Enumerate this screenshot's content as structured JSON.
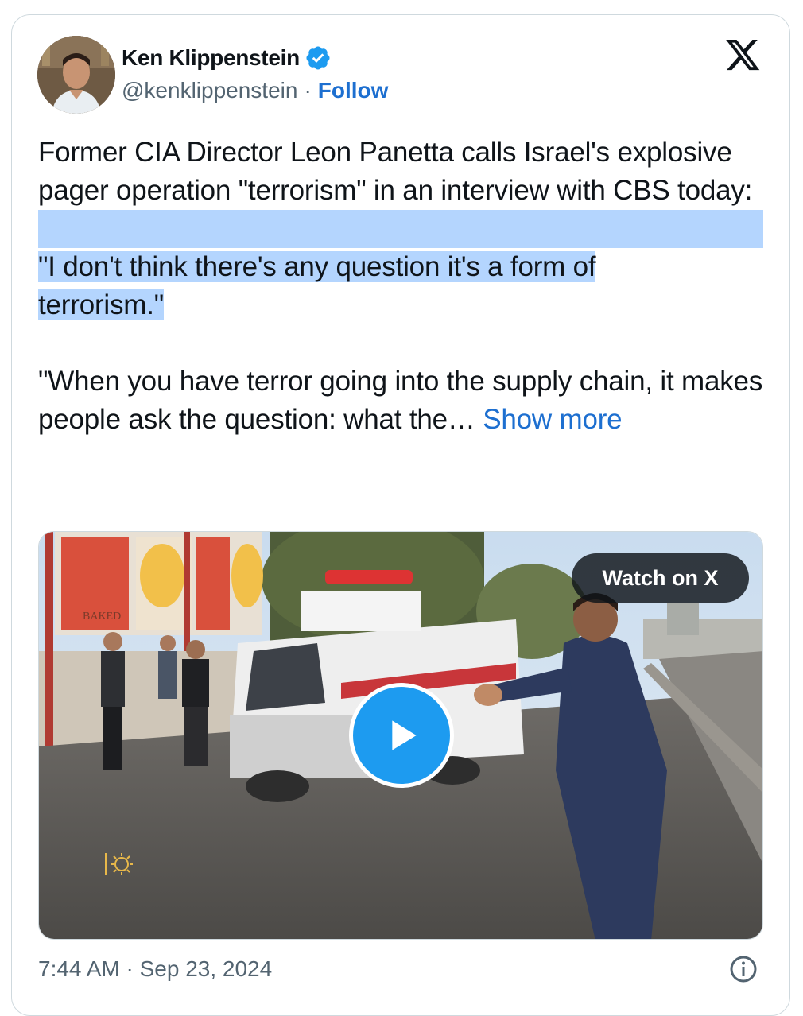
{
  "author": {
    "name": "Ken Klippenstein",
    "handle": "@kenklippenstein",
    "separator": "·",
    "follow_label": "Follow",
    "verified_icon": "verified-badge-icon"
  },
  "tweet": {
    "paragraph1": "Former CIA Director Leon Panetta calls Israel's explosive pager operation \"terrorism\" in an interview with CBS today:",
    "quote1_line1": "\"I don't think there's any question it's a form of",
    "quote1_line2": "terrorism.\"",
    "quote2": "\"When you have terror going into the supply chain, it makes people ask the question: what the…",
    "show_more": "Show more"
  },
  "media": {
    "watch_label": "Watch on X",
    "play_icon": "play-icon",
    "billboard_text": "BAKED"
  },
  "footer": {
    "timestamp": "7:44 AM · Sep 23, 2024",
    "info_icon": "info-icon"
  },
  "colors": {
    "link": "#1d6fd0",
    "highlight": "#b4d5fe",
    "muted": "#536471",
    "play": "#1d9bf0"
  }
}
